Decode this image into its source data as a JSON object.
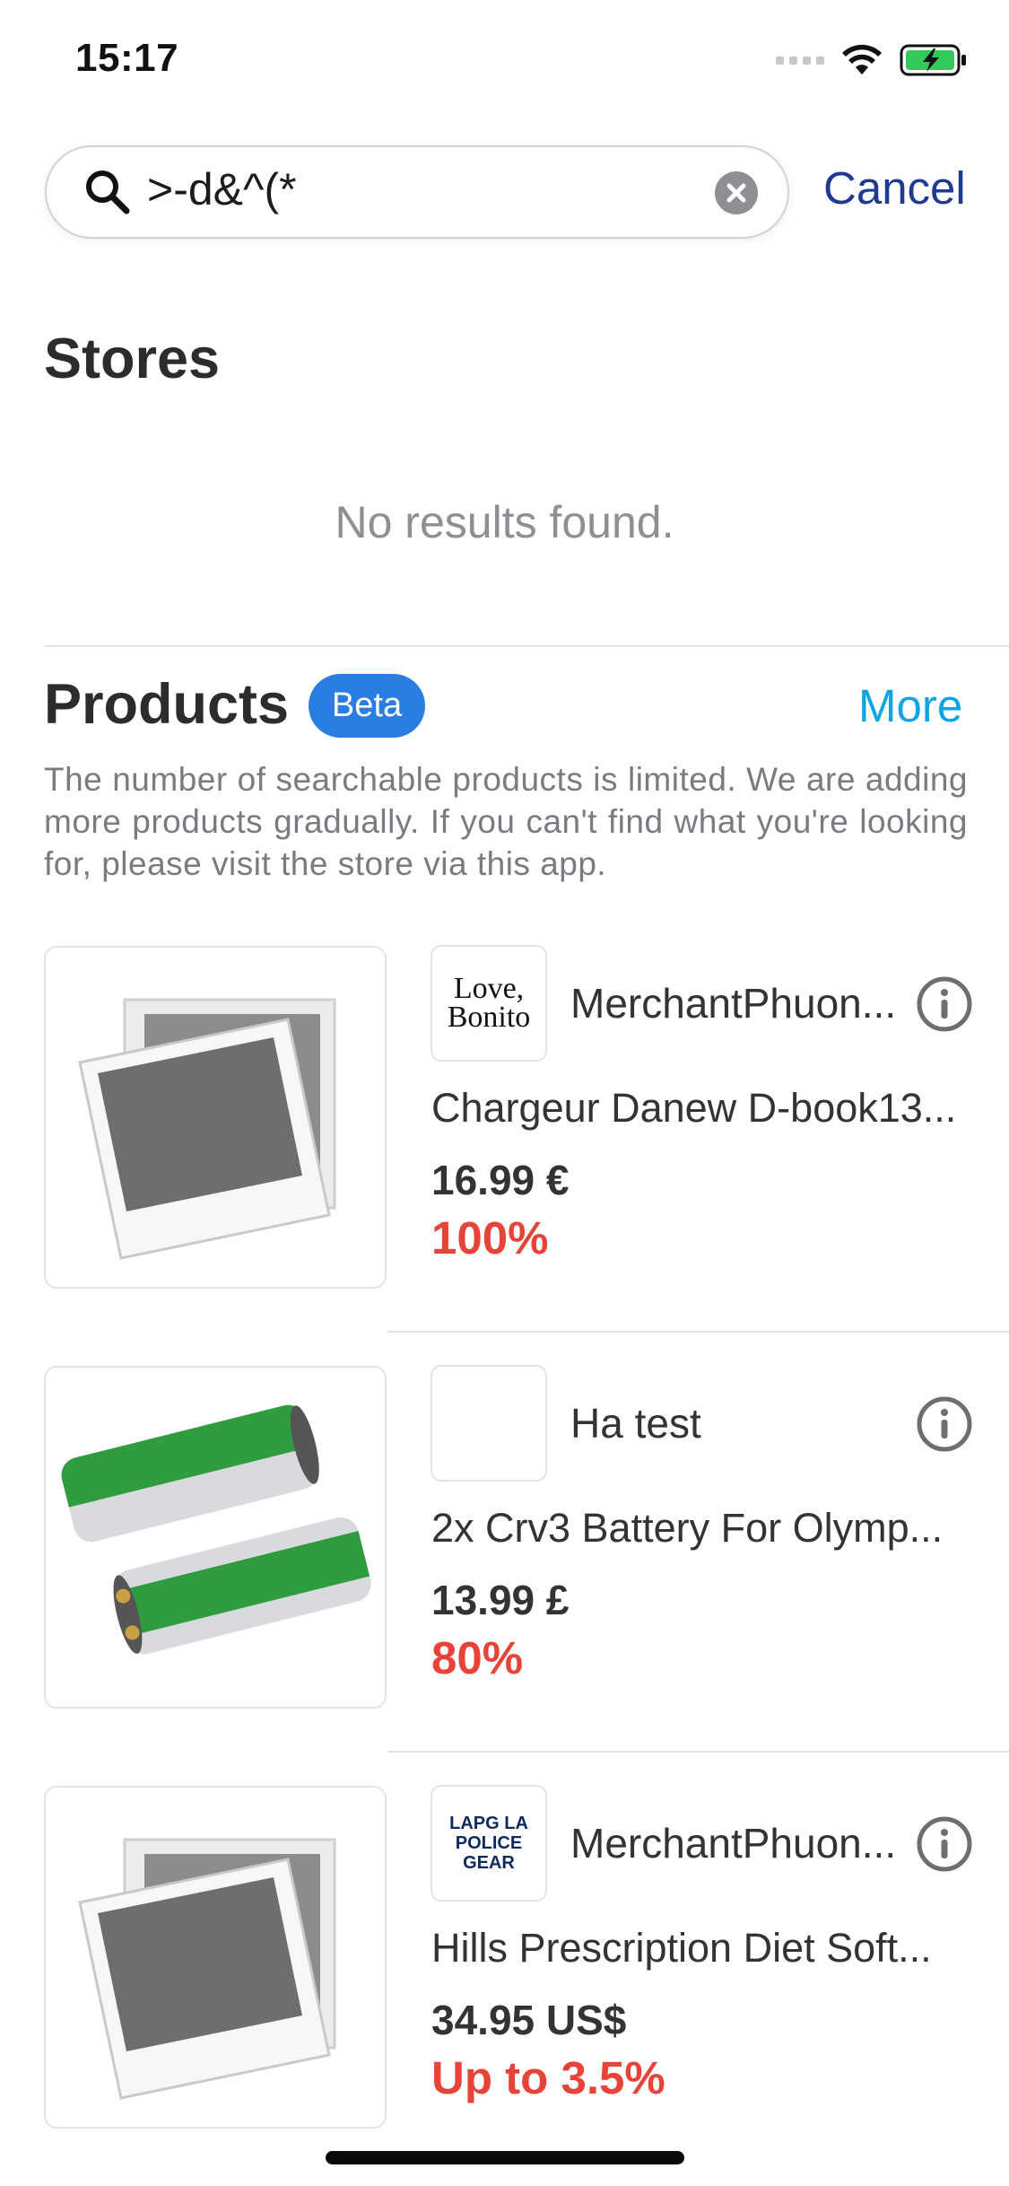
{
  "status_bar": {
    "time": "15:17"
  },
  "search": {
    "query": ">-d&^(*",
    "cancel_label": "Cancel"
  },
  "stores": {
    "title": "Stores",
    "empty_text": "No results found."
  },
  "products": {
    "title": "Products",
    "badge": "Beta",
    "more_label": "More",
    "description": "The number of searchable products is limited. We are adding more products gradually. If you can't find what you're looking for, please visit the store via this app.",
    "items": [
      {
        "merchant": "MerchantPhuon...",
        "merchant_logo_text": "Love, Bonito",
        "name": "Chargeur Danew D-book13...",
        "price": "16.99 €",
        "cashback": "100%"
      },
      {
        "merchant": "Ha test",
        "merchant_logo_text": "",
        "name": "2x Crv3 Battery For Olymp...",
        "price": "13.99 £",
        "cashback": "80%"
      },
      {
        "merchant": "MerchantPhuon...",
        "merchant_logo_text": "LAPG LA POLICE GEAR",
        "name": "Hills Prescription Diet Soft...",
        "price": "34.95 US$",
        "cashback": "Up to 3.5%"
      }
    ]
  },
  "colors": {
    "accent_blue": "#2a7de1",
    "cancel": "#1f3a93",
    "more": "#11a3e3",
    "cashback_red": "#e84338"
  }
}
